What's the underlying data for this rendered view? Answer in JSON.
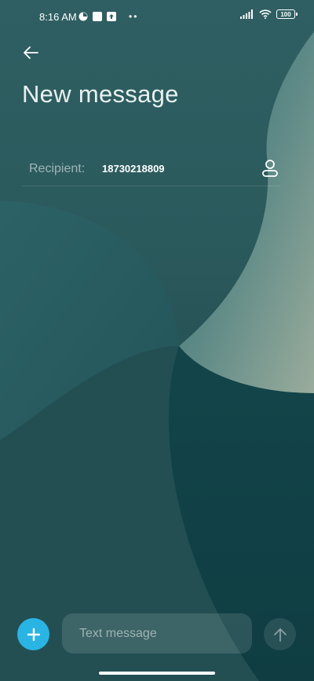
{
  "status_bar": {
    "time": "8:16 AM",
    "battery": "100",
    "icons": [
      "data-saver-icon",
      "screenshot-icon",
      "upload-icon",
      "more-dots-icon",
      "signal-icon",
      "wifi-icon",
      "battery-icon"
    ]
  },
  "header": {
    "back_icon": "arrow-left-icon",
    "title": "New message"
  },
  "recipient": {
    "label": "Recipient:",
    "value": "18730218809",
    "contact_icon": "person-icon"
  },
  "compose": {
    "add_icon": "plus-icon",
    "placeholder": "Text message",
    "value": "",
    "send_icon": "arrow-up-icon"
  },
  "colors": {
    "accent": "#2ab4e3",
    "background": "#2b5a5d"
  }
}
